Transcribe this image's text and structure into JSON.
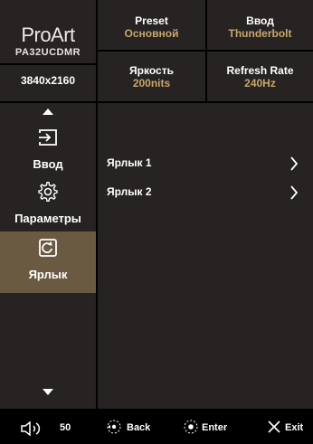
{
  "header": {
    "brand": "ProArt",
    "model": "PA32UCDMR",
    "resolution": "3840x2160",
    "preset": {
      "label": "Preset",
      "value": "Основной"
    },
    "input": {
      "label": "Ввод",
      "value": "Thunderbolt"
    },
    "brightness": {
      "label": "Яркость",
      "value": "200nits"
    },
    "refresh": {
      "label": "Refresh Rate",
      "value": "240Hz"
    }
  },
  "sidebar": {
    "items": [
      {
        "label": "Ввод",
        "icon": "input-icon"
      },
      {
        "label": "Параметры",
        "icon": "settings-gear-icon"
      },
      {
        "label": "Ярлык",
        "icon": "shortcut-icon",
        "selected": true
      }
    ]
  },
  "main": {
    "rows": [
      {
        "label": "Ярлык 1"
      },
      {
        "label": "Ярлык 2"
      }
    ]
  },
  "footer": {
    "volume": "50",
    "back": "Back",
    "enter": "Enter",
    "exit": "Exit"
  },
  "colors": {
    "panel": "#262322",
    "accent": "#c8a66b",
    "selected": "#6b5a42"
  }
}
